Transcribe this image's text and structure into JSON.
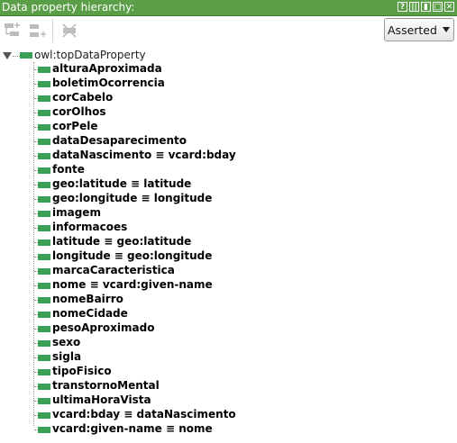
{
  "panel": {
    "title": "Data property hierarchy:",
    "controls": [
      "?",
      "||",
      "▮",
      "□",
      "✕"
    ]
  },
  "toolbar": {
    "add_subproperty_icon": "add-subproperty-icon",
    "add_sibling_icon": "add-sibling-property-icon",
    "delete_icon": "delete-property-icon",
    "mode_select": "Asserted"
  },
  "colors": {
    "titlebar": "#5a9e47",
    "property_bar": "#3aa055"
  },
  "tree": {
    "root": "owl:topDataProperty",
    "children": [
      "alturaAproximada",
      "boletimOcorrencia",
      "corCabelo",
      "corOlhos",
      "corPele",
      "dataDesaparecimento",
      "dataNascimento ≡ vcard:bday",
      "fonte",
      "geo:latitude ≡ latitude",
      "geo:longitude ≡ longitude",
      "imagem",
      "informacoes",
      "latitude ≡ geo:latitude",
      "longitude ≡ geo:longitude",
      "marcaCaracteristica",
      "nome ≡ vcard:given-name",
      "nomeBairro",
      "nomeCidade",
      "pesoAproximado",
      "sexo",
      "sigla",
      "tipoFisico",
      "transtornoMental",
      "ultimaHoraVista",
      "vcard:bday ≡ dataNascimento",
      "vcard:given-name ≡ nome"
    ]
  }
}
